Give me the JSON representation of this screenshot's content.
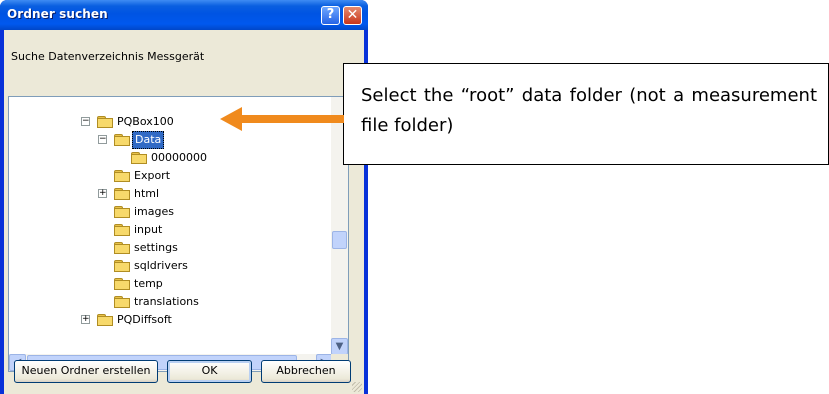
{
  "dialog": {
    "title": "Ordner suchen",
    "help_glyph": "?",
    "close_glyph": "✕",
    "instruction": "Suche Datenverzeichnis Messgerät"
  },
  "tree": {
    "items": [
      {
        "label": "PQBox100",
        "expander": "−",
        "selected": false
      },
      {
        "label": "Data",
        "expander": "−",
        "selected": true
      },
      {
        "label": "00000000",
        "expander": "",
        "selected": false
      },
      {
        "label": "Export",
        "expander": "",
        "selected": false
      },
      {
        "label": "html",
        "expander": "+",
        "selected": false
      },
      {
        "label": "images",
        "expander": "",
        "selected": false
      },
      {
        "label": "input",
        "expander": "",
        "selected": false
      },
      {
        "label": "settings",
        "expander": "",
        "selected": false
      },
      {
        "label": "sqldrivers",
        "expander": "",
        "selected": false
      },
      {
        "label": "temp",
        "expander": "",
        "selected": false
      },
      {
        "label": "translations",
        "expander": "",
        "selected": false
      },
      {
        "label": "PQDiffsoft",
        "expander": "+",
        "selected": false
      }
    ]
  },
  "scroll": {
    "up_glyph": "▲",
    "down_glyph": "▼",
    "left_glyph": "◀",
    "right_glyph": "▶"
  },
  "buttons": {
    "new_folder": "Neuen Ordner erstellen",
    "ok": "OK",
    "cancel": "Abbrechen"
  },
  "callout": {
    "text": "Select the “root” data folder (not a measurement file folder)"
  },
  "colors": {
    "arrow": "#f08a1d",
    "selection": "#316ac5",
    "titlebar": "#0054e3"
  }
}
